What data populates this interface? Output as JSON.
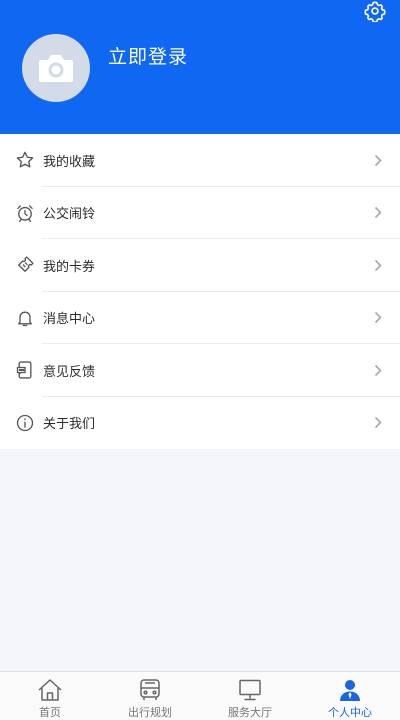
{
  "header": {
    "login_text": "立即登录",
    "background": "#1067f2"
  },
  "menu": {
    "items": [
      {
        "label": "我的收藏",
        "icon": "star-icon"
      },
      {
        "label": "公交闹铃",
        "icon": "alarm-clock-icon"
      },
      {
        "label": "我的卡券",
        "icon": "ticket-icon"
      },
      {
        "label": "消息中心",
        "icon": "bell-icon"
      },
      {
        "label": "意见反馈",
        "icon": "feedback-icon"
      },
      {
        "label": "关于我们",
        "icon": "info-icon"
      }
    ]
  },
  "tabbar": {
    "active_index": 3,
    "active_color": "#1a66e0",
    "tabs": [
      {
        "label": "首页",
        "icon": "home-icon"
      },
      {
        "label": "出行规划",
        "icon": "bus-icon"
      },
      {
        "label": "服务大厅",
        "icon": "monitor-icon"
      },
      {
        "label": "个人中心",
        "icon": "person-icon"
      }
    ]
  }
}
